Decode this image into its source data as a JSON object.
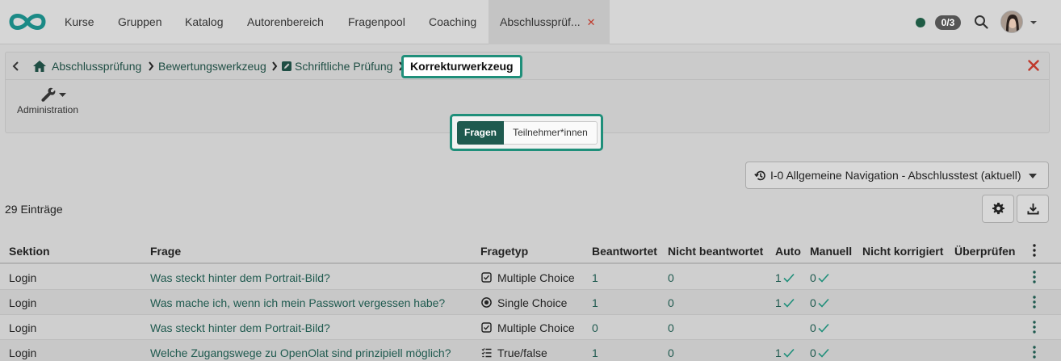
{
  "nav": {
    "items": [
      "Kurse",
      "Gruppen",
      "Katalog",
      "Autorenbereich",
      "Fragenpool",
      "Coaching"
    ],
    "active_tab": "Abschlussprüf...",
    "counter": "0/3",
    "colors": {
      "accent": "#1f8f7a",
      "dark_green": "#1f5a4f",
      "close_red": "#c0392b"
    }
  },
  "breadcrumb": {
    "items": [
      "Abschlussprüfung",
      "Bewertungswerkzeug",
      "Schriftliche Prüfung"
    ],
    "current": "Korrekturwerkzeug"
  },
  "toolbar": {
    "admin_label": "Administration"
  },
  "segmented": {
    "fragen": "Fragen",
    "teilnehmer": "Teilnehmer*innen",
    "selected": "Fragen"
  },
  "version_select": {
    "value": "I-0 Allgemeine Navigation - Abschlusstest (aktuell)"
  },
  "table": {
    "count_label": "29 Einträge",
    "headers": [
      "Sektion",
      "Frage",
      "Fragetyp",
      "Beantwortet",
      "Nicht beantwortet",
      "Auto",
      "Manuell",
      "Nicht korrigiert",
      "Überprüfen"
    ],
    "rows": [
      {
        "sektion": "Login",
        "frage": "Was steckt hinter dem Portrait-Bild?",
        "typ": "Multiple Choice",
        "typ_icon": "checkbox-icon",
        "beantwortet": "1",
        "nicht_beantwortet": "0",
        "auto": "1",
        "manuell": "0"
      },
      {
        "sektion": "Login",
        "frage": "Was mache ich, wenn ich mein Passwort vergessen habe?",
        "typ": "Single Choice",
        "typ_icon": "radio-icon",
        "beantwortet": "1",
        "nicht_beantwortet": "0",
        "auto": "1",
        "manuell": "0"
      },
      {
        "sektion": "Login",
        "frage": "Was steckt hinter dem Portrait-Bild?",
        "typ": "Multiple Choice",
        "typ_icon": "checkbox-icon",
        "beantwortet": "0",
        "nicht_beantwortet": "0",
        "auto": "",
        "manuell": "0"
      },
      {
        "sektion": "Login",
        "frage": "Welche Zugangswege zu OpenOlat sind prinzipiell möglich?",
        "typ": "True/false",
        "typ_icon": "list-icon",
        "beantwortet": "1",
        "nicht_beantwortet": "0",
        "auto": "1",
        "manuell": "0"
      }
    ]
  }
}
